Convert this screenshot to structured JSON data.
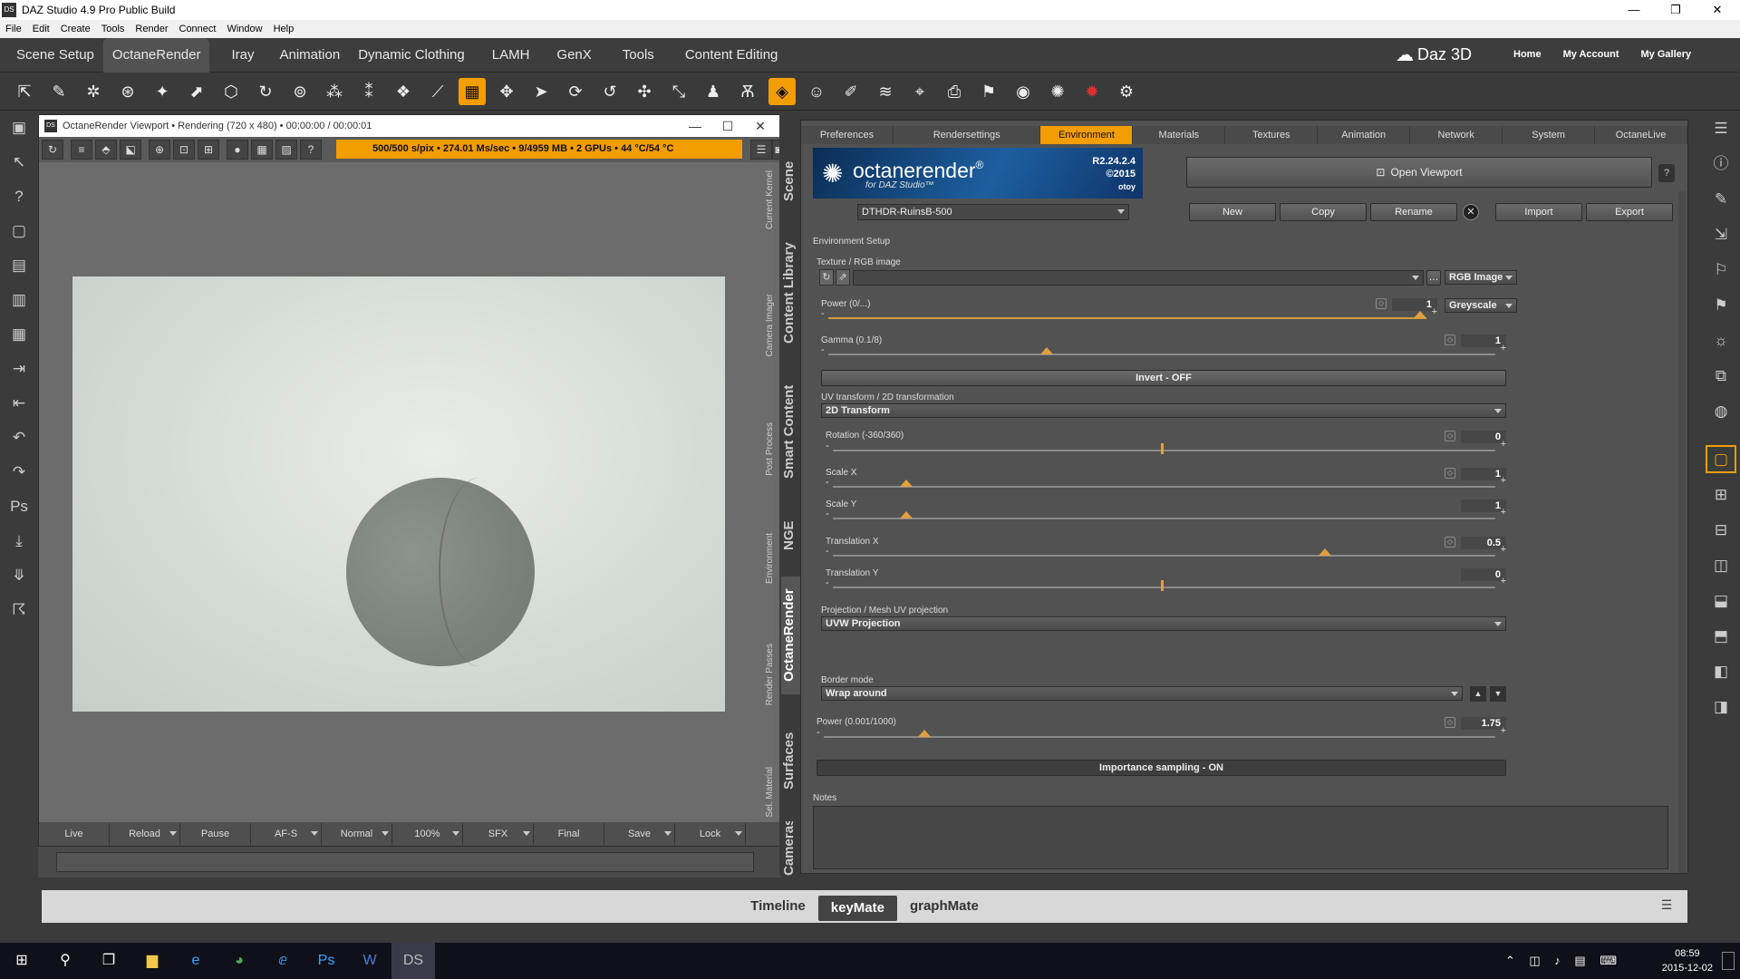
{
  "window": {
    "title": "DAZ Studio 4.9 Pro Public Build",
    "icon": "DS"
  },
  "menu": [
    "File",
    "Edit",
    "Create",
    "Tools",
    "Render",
    "Connect",
    "Window",
    "Help"
  ],
  "tabs": [
    "Scene Setup",
    "OctaneRender",
    "Iray",
    "Animation",
    "Dynamic Clothing",
    "LAMH",
    "GenX",
    "Tools",
    "Content Editing"
  ],
  "active_tab": "OctaneRender",
  "brand": "Daz 3D",
  "top_links": [
    "Home",
    "My Account",
    "My Gallery"
  ],
  "viewport": {
    "title": "OctaneRender Viewport • Rendering (720 x 480) • 00:00:00 / 00:00:01",
    "status": "500/500 s/pix • 274.01 Ms/sec • 9/4959 MB • 2 GPUs • 44 °C/54 °C",
    "bottom_buttons": [
      {
        "label": "Live",
        "on": true,
        "dd": false
      },
      {
        "label": "Reload",
        "on": false,
        "dd": true
      },
      {
        "label": "Pause",
        "on": false,
        "dd": false
      },
      {
        "label": "AF-S",
        "on": true,
        "dd": true
      },
      {
        "label": "Normal",
        "on": false,
        "dd": true
      },
      {
        "label": "100%",
        "on": false,
        "dd": true
      },
      {
        "label": "SFX",
        "on": false,
        "dd": true
      },
      {
        "label": "Final",
        "on": false,
        "dd": false
      },
      {
        "label": "Save",
        "on": false,
        "dd": true
      },
      {
        "label": "Lock",
        "on": false,
        "dd": true
      }
    ]
  },
  "side_small_tabs": [
    "Current Kernel",
    "Camera Imager",
    "Post Process",
    "Environment",
    "Render Passes",
    "Sel. Material"
  ],
  "side_big_tabs": [
    "Scene",
    "Content Library",
    "Smart Content",
    "NGE",
    "OctaneRender",
    "Surfaces",
    "Cameras"
  ],
  "side_big_active": "OctaneRender",
  "panel": {
    "tabs": [
      "Preferences",
      "Rendersettings",
      "Environment",
      "Materials",
      "Textures",
      "Animation",
      "Network",
      "System",
      "OctaneLive"
    ],
    "active_tab": "Environment",
    "logo": {
      "text": "octanerender",
      "reg": "®",
      "sub": "for DAZ Studio™",
      "version": "R2.24.2.4",
      "year": "©2015",
      "company": "otoy"
    },
    "open_viewport": "Open Viewport",
    "preset": "DTHDR-RuinsB-500",
    "preset_buttons": [
      "New",
      "Copy",
      "Rename",
      "Import",
      "Export"
    ],
    "section": "Environment Setup",
    "texture_label": "Texture / RGB image",
    "texture_type": "RGB Image",
    "greyscale": "Greyscale",
    "power_label": "Power (0/...)",
    "power_value": "1",
    "power_level": 1.0,
    "gamma_label": "Gamma (0.1/8)",
    "gamma_value": "1",
    "gamma_level": 0.33,
    "invert": "Invert - OFF",
    "uv_label": "UV transform / 2D transformation",
    "uv_value": "2D Transform",
    "rotation_label": "Rotation (-360/360)",
    "rotation_value": "0",
    "rotation_level": 0.5,
    "scalex_label": "Scale X",
    "scalex_value": "1",
    "scalex_level": 0.11,
    "scaley_label": "Scale Y",
    "scaley_value": "1",
    "scaley_level": 0.11,
    "transx_label": "Translation X",
    "transx_value": "0.5",
    "transx_level": 0.75,
    "transy_label": "Translation Y",
    "transy_value": "0",
    "transy_level": 0.5,
    "projection_label": "Projection / Mesh UV projection",
    "projection_value": "UVW Projection",
    "border_label": "Border mode",
    "border_value": "Wrap around",
    "power2_label": "Power (0.001/1000)",
    "power2_value": "1.75",
    "power2_level": 0.15,
    "importance": "Importance sampling - ON",
    "notes": "Notes"
  },
  "bottom_tabs": [
    "Timeline",
    "keyMate",
    "graphMate"
  ],
  "bottom_active": "keyMate",
  "clock": {
    "time": "08:59",
    "date": "2015-12-02"
  },
  "colors": {
    "accent": "#f29d00"
  }
}
